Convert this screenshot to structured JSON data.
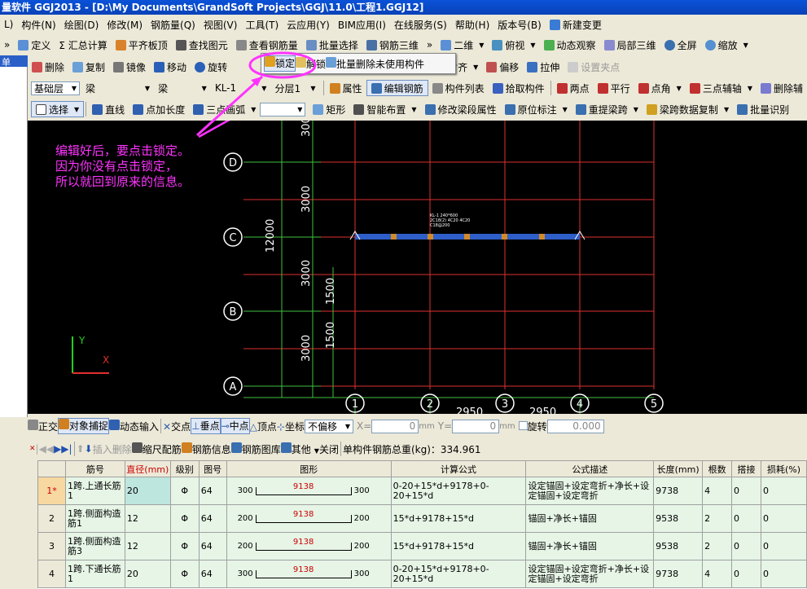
{
  "title": "量软件 GGJ2013 - [D:\\My Documents\\GrandSoft Projects\\GGJ\\11.0\\工程1.GGJ12]",
  "menu": [
    "L)",
    "构件(N)",
    "绘图(D)",
    "修改(M)",
    "钢筋量(Q)",
    "视图(V)",
    "工具(T)",
    "云应用(Y)",
    "BIM应用(I)",
    "在线服务(S)",
    "帮助(H)",
    "版本号(B)",
    "新建变更"
  ],
  "tb1": [
    "定义",
    "Σ 汇总计算",
    "平齐板顶",
    "查找图元",
    "查看钢筋量",
    "批量选择",
    "钢筋三维",
    "二维",
    "俯视",
    "动态观察",
    "局部三维",
    "全屏",
    "缩放"
  ],
  "tb2": [
    "删除",
    "复制",
    "镜像",
    "移动",
    "旋转",
    "解锁",
    "批量删除未使用构件",
    "对齐",
    "偏移",
    "拉伸",
    "设置夹点"
  ],
  "lock_label": "锁定",
  "tb3": {
    "floor": "基础层",
    "type1": "梁",
    "type2": "梁",
    "comp": "KL-1",
    "layer": "分层1",
    "items": [
      "属性",
      "编辑钢筋",
      "构件列表",
      "拾取构件",
      "两点",
      "平行",
      "点角",
      "三点辅轴",
      "删除辅"
    ]
  },
  "tb4": {
    "select": "选择",
    "items": [
      "直线",
      "点加长度",
      "三点画弧"
    ],
    "items2": [
      "矩形",
      "智能布置",
      "修改梁段属性",
      "原位标注",
      "重提梁跨",
      "梁跨数据复制",
      "批量识别"
    ]
  },
  "left_label": "单",
  "annotation": [
    "编辑好后，要点击锁定。",
    "因为你没有点击锁定，",
    "所以就回到原来的信息。"
  ],
  "canvas": {
    "rows": [
      "D",
      "C",
      "B",
      "A"
    ],
    "cols": [
      "1",
      "2",
      "3",
      "4",
      "5"
    ],
    "dims_left": [
      "3000",
      "3000",
      "3000",
      "3000"
    ],
    "total": "12000",
    "half": [
      "1500",
      "1500"
    ],
    "bottom_dims": [
      "2950",
      "2950"
    ],
    "beam_label": [
      "KL-1 240*600",
      "2C18(2) 4C20 4C20",
      "C18@200"
    ]
  },
  "status": {
    "items": [
      "正交",
      "对象捕捉",
      "动态输入",
      "交点",
      "垂点",
      "中点",
      "顶点",
      "坐标"
    ],
    "offset": "不偏移",
    "x_label": "X=",
    "x": "0",
    "y_label": "Y=",
    "y": "0",
    "unit": "mm",
    "rotate": "旋转",
    "angle": "0.000"
  },
  "rebar_toolbar": {
    "items": [
      "插入",
      "删除",
      "缩尺配筋",
      "钢筋信息",
      "钢筋图库",
      "其他",
      "关闭"
    ],
    "total": "单构件钢筋总重(kg)：334.961"
  },
  "table": {
    "headers": [
      "",
      "筋号",
      "直径(mm)",
      "级别",
      "图号",
      "图形",
      "计算公式",
      "公式描述",
      "长度(mm)",
      "根数",
      "搭接",
      "损耗(%)"
    ],
    "rows": [
      {
        "n": "1*",
        "name": "1跨.上通长筋1",
        "d": "20",
        "g": "Φ",
        "fig": "64",
        "l": "300",
        "m": "9138",
        "r": "300",
        "formula": "0-20+15*d+9178+0-20+15*d",
        "desc": "设定锚固+设定弯折+净长+设定锚固+设定弯折",
        "len": "9738",
        "cnt": "4",
        "lap": "0",
        "loss": "0"
      },
      {
        "n": "2",
        "name": "1跨.侧面构造筋1",
        "d": "12",
        "g": "Φ",
        "fig": "64",
        "l": "200",
        "m": "9138",
        "r": "200",
        "formula": "15*d+9178+15*d",
        "desc": "锚固+净长+锚固",
        "len": "9538",
        "cnt": "2",
        "lap": "0",
        "loss": "0"
      },
      {
        "n": "3",
        "name": "1跨.侧面构造筋3",
        "d": "12",
        "g": "Φ",
        "fig": "64",
        "l": "200",
        "m": "9138",
        "r": "200",
        "formula": "15*d+9178+15*d",
        "desc": "锚固+净长+锚固",
        "len": "9538",
        "cnt": "2",
        "lap": "0",
        "loss": "0"
      },
      {
        "n": "4",
        "name": "1跨.下通长筋1",
        "d": "20",
        "g": "Φ",
        "fig": "64",
        "l": "300",
        "m": "9138",
        "r": "300",
        "formula": "0-20+15*d+9178+0-20+15*d",
        "desc": "设定锚固+设定弯折+净长+设定锚固+设定弯折",
        "len": "9738",
        "cnt": "4",
        "lap": "0",
        "loss": "0"
      }
    ]
  }
}
